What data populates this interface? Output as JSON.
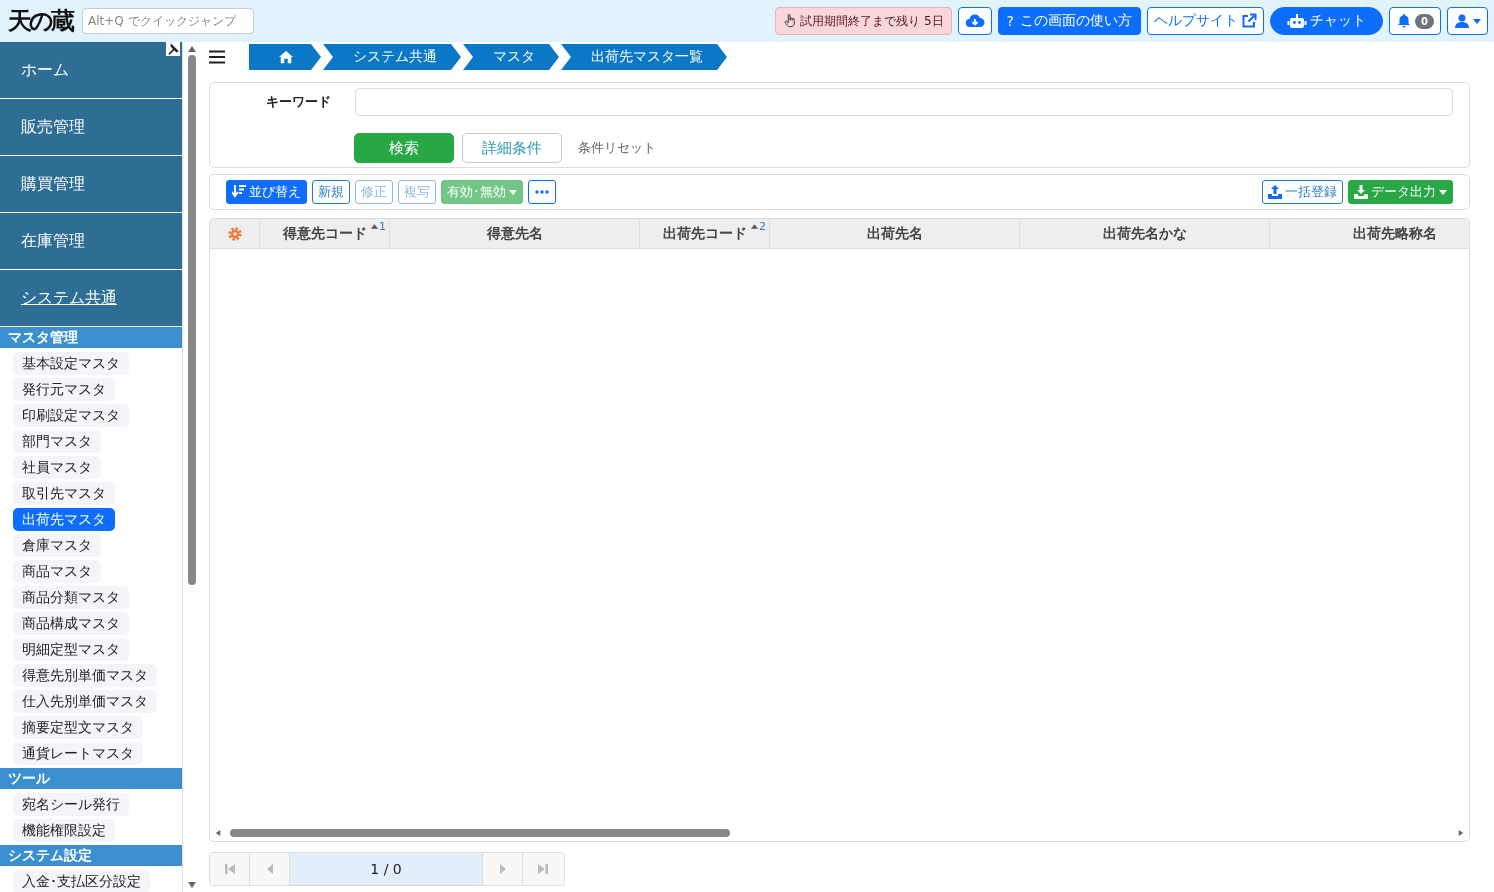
{
  "header": {
    "logo": "天の蔵",
    "quick_jump": {
      "placeholder": "Alt+Q でクイックジャンプ"
    },
    "trial_notice": "試用期間終了まで残り 5日",
    "help_mark": "?",
    "help_button": "この画面の使い方",
    "help_site": "ヘルプサイト",
    "chat": "チャット",
    "notification_count": "0"
  },
  "sidebar": {
    "nav": [
      {
        "label": "ホーム",
        "selected": false
      },
      {
        "label": "販売管理",
        "selected": false
      },
      {
        "label": "購買管理",
        "selected": false
      },
      {
        "label": "在庫管理",
        "selected": false
      },
      {
        "label": "システム共通",
        "selected": true
      }
    ],
    "sections": [
      {
        "title": "マスタ管理",
        "items": [
          {
            "label": "基本設定マスタ",
            "selected": false
          },
          {
            "label": "発行元マスタ",
            "selected": false
          },
          {
            "label": "印刷設定マスタ",
            "selected": false
          },
          {
            "label": "部門マスタ",
            "selected": false
          },
          {
            "label": "社員マスタ",
            "selected": false
          },
          {
            "label": "取引先マスタ",
            "selected": false
          },
          {
            "label": "出荷先マスタ",
            "selected": true
          },
          {
            "label": "倉庫マスタ",
            "selected": false
          },
          {
            "label": "商品マスタ",
            "selected": false
          },
          {
            "label": "商品分類マスタ",
            "selected": false
          },
          {
            "label": "商品構成マスタ",
            "selected": false
          },
          {
            "label": "明細定型マスタ",
            "selected": false
          },
          {
            "label": "得意先別単価マスタ",
            "selected": false
          },
          {
            "label": "仕入先別単価マスタ",
            "selected": false
          },
          {
            "label": "摘要定型文マスタ",
            "selected": false
          },
          {
            "label": "通貨レートマスタ",
            "selected": false
          }
        ]
      },
      {
        "title": "ツール",
        "items": [
          {
            "label": "宛名シール発行",
            "selected": false
          },
          {
            "label": "機能権限設定",
            "selected": false
          }
        ]
      },
      {
        "title": "システム設定",
        "items": [
          {
            "label": "入金･支払区分設定",
            "selected": false
          }
        ]
      }
    ]
  },
  "breadcrumb": [
    "システム共通",
    "マスタ",
    "出荷先マスタ一覧"
  ],
  "search": {
    "keyword_label": "キーワード",
    "search_button": "検索",
    "detail_button": "詳細条件",
    "reset_link": "条件リセット"
  },
  "toolbar": {
    "left": [
      {
        "kind": "primary",
        "label": "並び替え",
        "disabled": false,
        "dropdown": false
      },
      {
        "kind": "outline",
        "label": "新規",
        "disabled": false,
        "dropdown": false
      },
      {
        "kind": "outline",
        "label": "修正",
        "disabled": true,
        "dropdown": false
      },
      {
        "kind": "outline",
        "label": "複写",
        "disabled": true,
        "dropdown": false
      },
      {
        "kind": "success",
        "label": "有効･無効",
        "disabled": true,
        "dropdown": true
      },
      {
        "kind": "more",
        "disabled": false,
        "dropdown": false
      }
    ],
    "right": [
      {
        "kind": "outline",
        "label": "一括登録",
        "disabled": false,
        "dropdown": false
      },
      {
        "kind": "success",
        "label": "データ出力",
        "disabled": false,
        "dropdown": true
      }
    ]
  },
  "table": {
    "columns": [
      {
        "label": "得意先コード",
        "sort_order": "1"
      },
      {
        "label": "得意先名"
      },
      {
        "label": "出荷先コード",
        "sort_order": "2"
      },
      {
        "label": "出荷先名"
      },
      {
        "label": "出荷先名かな"
      },
      {
        "label": "出荷先略称名"
      }
    ]
  },
  "pagination": {
    "page": "1 / 0"
  }
}
